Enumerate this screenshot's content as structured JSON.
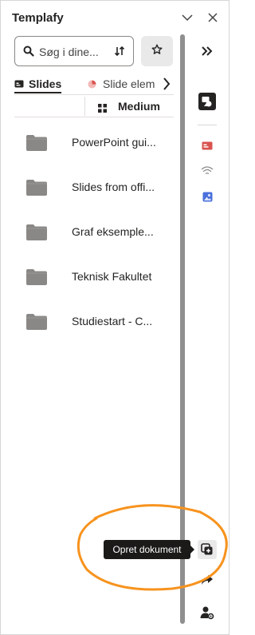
{
  "pane": {
    "title": "Templafy"
  },
  "search": {
    "placeholder": "Søg i dine..."
  },
  "tabs": [
    {
      "label": "Slides",
      "icon": "slides-icon",
      "active": true
    },
    {
      "label": "Slide elem",
      "icon": "chart-pie-icon",
      "active": false
    }
  ],
  "view": {
    "label": "Medium"
  },
  "folders": [
    {
      "name": "PowerPoint gui..."
    },
    {
      "name": "Slides from offi..."
    },
    {
      "name": "Graf eksemple..."
    },
    {
      "name": "Teknisk Fakultet"
    },
    {
      "name": "Studiestart - C..."
    }
  ],
  "tooltip": {
    "text": "Opret dokument"
  },
  "colors": {
    "annotation": "#f7931e",
    "tooltip_bg": "#1b1a19",
    "folder": "#8a8886",
    "accent_red": "#d9534f",
    "accent_blue": "#4a6fdc"
  }
}
